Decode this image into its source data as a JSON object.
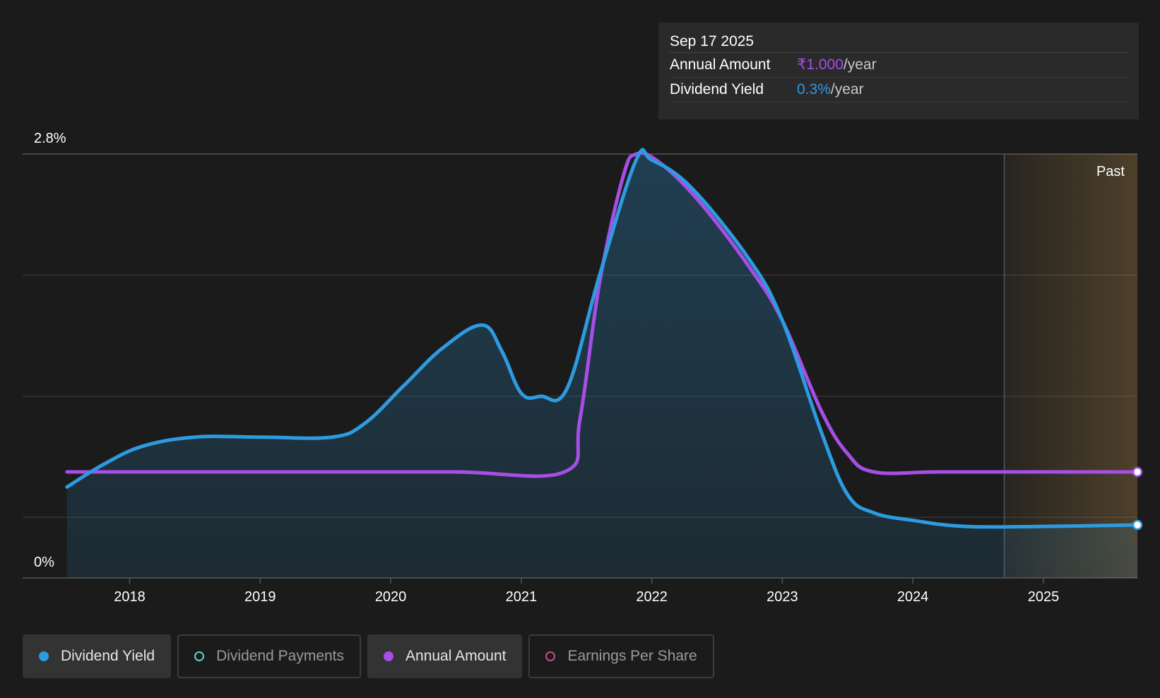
{
  "tooltip": {
    "date": "Sep 17 2025",
    "rows": [
      {
        "label": "Annual Amount",
        "value": "₹1.000",
        "unit": "/year"
      },
      {
        "label": "Dividend Yield",
        "value": "0.3%",
        "unit": "/year"
      }
    ]
  },
  "legend": [
    {
      "label": "Dividend Yield",
      "color": "#2d9be0",
      "active": true,
      "filled": true
    },
    {
      "label": "Dividend Payments",
      "color": "#5fd3c4",
      "active": false,
      "filled": false
    },
    {
      "label": "Annual Amount",
      "color": "#a64ee6",
      "active": true,
      "filled": true
    },
    {
      "label": "Earnings Per Share",
      "color": "#c24e8a",
      "active": false,
      "filled": false
    }
  ],
  "chart_data": {
    "type": "line",
    "ylim": [
      0,
      2.8
    ],
    "y_tick_labels": [
      "2.8%",
      "0%"
    ],
    "xlim": [
      2017.18,
      2025.72
    ],
    "x_tick_values": [
      2018,
      2019,
      2020,
      2021,
      2022,
      2023,
      2024,
      2025
    ],
    "x_tick_labels": [
      "2018",
      "2019",
      "2020",
      "2021",
      "2022",
      "2023",
      "2024",
      "2025"
    ],
    "grid": true,
    "past_region": {
      "label": "Past",
      "from": 2024.7,
      "to": 2025.72
    },
    "series": [
      {
        "name": "Dividend Yield",
        "color": "#2d9be0",
        "fill": true,
        "points": [
          [
            2017.52,
            0.6
          ],
          [
            2017.8,
            0.75
          ],
          [
            2018.1,
            0.87
          ],
          [
            2018.5,
            0.93
          ],
          [
            2019.0,
            0.93
          ],
          [
            2019.55,
            0.93
          ],
          [
            2019.8,
            1.02
          ],
          [
            2020.1,
            1.27
          ],
          [
            2020.4,
            1.52
          ],
          [
            2020.7,
            1.67
          ],
          [
            2020.85,
            1.5
          ],
          [
            2021.0,
            1.22
          ],
          [
            2021.15,
            1.2
          ],
          [
            2021.35,
            1.25
          ],
          [
            2021.6,
            2.0
          ],
          [
            2021.88,
            2.76
          ],
          [
            2022.0,
            2.76
          ],
          [
            2022.3,
            2.58
          ],
          [
            2022.75,
            2.1
          ],
          [
            2023.0,
            1.7
          ],
          [
            2023.3,
            0.96
          ],
          [
            2023.5,
            0.55
          ],
          [
            2023.7,
            0.43
          ],
          [
            2024.0,
            0.38
          ],
          [
            2024.4,
            0.34
          ],
          [
            2025.0,
            0.34
          ],
          [
            2025.72,
            0.35
          ]
        ]
      },
      {
        "name": "Annual Amount",
        "color": "#a64ee6",
        "fill": false,
        "points": [
          [
            2017.52,
            0.7
          ],
          [
            2018.5,
            0.7
          ],
          [
            2019.5,
            0.7
          ],
          [
            2020.5,
            0.7
          ],
          [
            2021.33,
            0.7
          ],
          [
            2021.45,
            1.05
          ],
          [
            2021.6,
            1.95
          ],
          [
            2021.78,
            2.65
          ],
          [
            2021.88,
            2.8
          ],
          [
            2022.05,
            2.75
          ],
          [
            2022.35,
            2.5
          ],
          [
            2022.75,
            2.05
          ],
          [
            2023.0,
            1.7
          ],
          [
            2023.3,
            1.1
          ],
          [
            2023.5,
            0.82
          ],
          [
            2023.7,
            0.7
          ],
          [
            2024.2,
            0.7
          ],
          [
            2025.0,
            0.7
          ],
          [
            2025.72,
            0.7
          ]
        ]
      }
    ]
  }
}
